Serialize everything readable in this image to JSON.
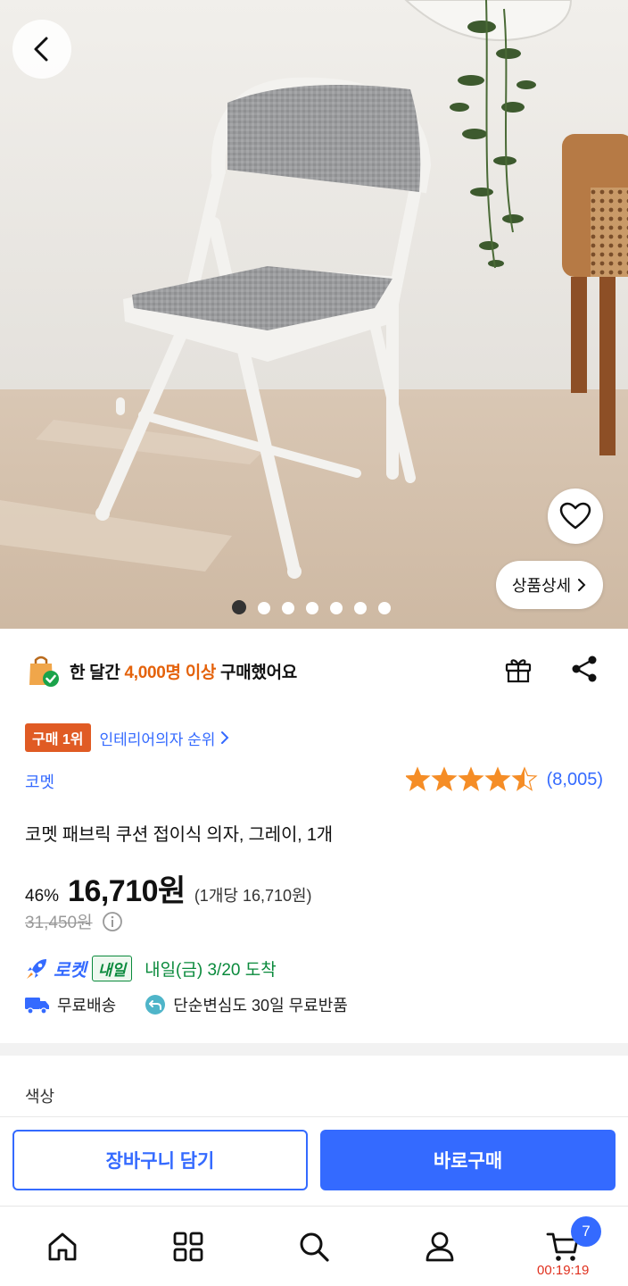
{
  "hero": {
    "detail_label": "상품상세",
    "image_count": 7,
    "active_image": 1
  },
  "social_proof": {
    "prefix": "한 달간 ",
    "highlight": "4,000명 이상",
    "suffix": " 구매했어요"
  },
  "ranking": {
    "badge": "구매 1위",
    "category_link": "인테리어의자 순위"
  },
  "product": {
    "brand": "코멧",
    "rating": 4.5,
    "review_count": "(8,005)",
    "title": "코멧 패브릭 쿠션 접이식 의자, 그레이, 1개",
    "discount": "46%",
    "price": "16,710원",
    "unit_price": "(1개당 16,710원)",
    "original_price": "31,450원"
  },
  "delivery": {
    "rocket_label": "로켓",
    "rocket_tag": "내일",
    "arrival": "내일(금) 3/20 도착",
    "free_shipping": "무료배송",
    "free_return": "단순변심도 30일 무료반품"
  },
  "options": {
    "color_label": "색상"
  },
  "actions": {
    "cart_label": "장바구니 담기",
    "buy_label": "바로구매"
  },
  "nav": {
    "cart_count": "7",
    "timer": "00:19:19"
  },
  "colors": {
    "accent": "#346aff",
    "highlight_orange": "#e4620b",
    "rank_badge": "#e05b24",
    "rocket_green": "#0a8a3c",
    "star": "#f58d26",
    "timer_red": "#e0301e"
  }
}
